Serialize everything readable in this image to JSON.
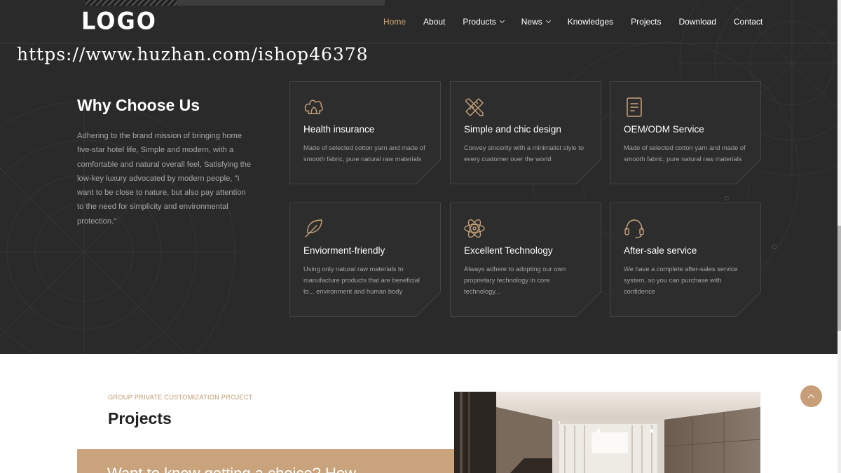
{
  "header": {
    "logo": "LOGO",
    "nav": [
      {
        "label": "Home",
        "active": true,
        "dropdown": false
      },
      {
        "label": "About",
        "active": false,
        "dropdown": false
      },
      {
        "label": "Products",
        "active": false,
        "dropdown": true
      },
      {
        "label": "News",
        "active": false,
        "dropdown": true
      },
      {
        "label": "Knowledges",
        "active": false,
        "dropdown": false
      },
      {
        "label": "Projects",
        "active": false,
        "dropdown": false
      },
      {
        "label": "Download",
        "active": false,
        "dropdown": false
      },
      {
        "label": "Contact",
        "active": false,
        "dropdown": false
      }
    ]
  },
  "watermark": "https://www.huzhan.com/ishop46378",
  "why": {
    "title": "Why Choose Us",
    "description": "Adhering to the brand mission of bringing home five-star hotel life, Simple and modern, with a comfortable and natural overall feel, Satisfying the low-key luxury advocated by modern people, \"I want to be close to nature, but also pay attention to the need for simplicity and environmental protection.\"",
    "cards": [
      {
        "icon": "cotton-icon",
        "title": "Health insurance",
        "text": "Made of selected cotton yarn and made of smooth fabric, pure natural raw materials"
      },
      {
        "icon": "pencil-ruler-icon",
        "title": "Simple and chic design",
        "text": "Convey sincerity with a minimalist style to every customer over the world"
      },
      {
        "icon": "document-icon",
        "title": "OEM/ODM Service",
        "text": "Made of selected cotton yarn and made of smooth fabric, pure natural raw materials"
      },
      {
        "icon": "leaf-icon",
        "title": "Enviorment-friendly",
        "text": "Using only natural raw materials to manufacture products that are beneficial to... environment and human body"
      },
      {
        "icon": "atom-icon",
        "title": "Excellent Technology",
        "text": "Always adhere to adopting our own proprietary technology in core technology..."
      },
      {
        "icon": "headset-icon",
        "title": "After-sale service",
        "text": "We have a complete after-sales service system, so you can purchase with confidence"
      }
    ]
  },
  "projects": {
    "eyebrow": "GROUP PRIVATE CUSTOMIZATION PROJECT",
    "title": "Projects",
    "banner_text": "Want to know getting a choice? How"
  },
  "colors": {
    "dark_bg": "#2a2a2a",
    "accent": "#c8a37c",
    "nav_active": "#d4a676"
  }
}
